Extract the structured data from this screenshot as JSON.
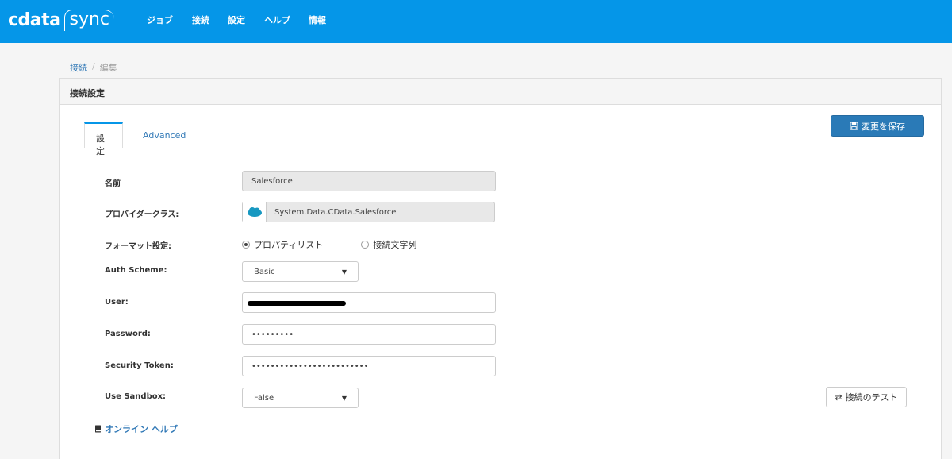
{
  "nav": {
    "logo_cdata": "cdata",
    "logo_sync": "sync",
    "items": [
      "ジョブ",
      "接続",
      "設定",
      "ヘルプ",
      "情報"
    ]
  },
  "breadcrumb": {
    "link": "接続",
    "separator": "/",
    "current": "編集"
  },
  "panel": {
    "title": "接続設定"
  },
  "tabs": {
    "settings": "設定",
    "advanced": "Advanced"
  },
  "save_button": "変更を保存",
  "form": {
    "name_label": "名前",
    "name_value": "Salesforce",
    "provider_label": "プロバイダークラス:",
    "provider_value": "System.Data.CData.Salesforce",
    "format_label": "フォーマット設定:",
    "format_options": [
      "プロパティリスト",
      "接続文字列"
    ],
    "auth_label": "Auth Scheme:",
    "auth_value": "Basic",
    "user_label": "User:",
    "password_label": "Password:",
    "password_value": "•••••••••",
    "token_label": "Security Token:",
    "token_value": "•••••••••••••••••••••••••",
    "sandbox_label": "Use Sandbox:",
    "sandbox_value": "False"
  },
  "test_button": "接続のテスト",
  "help_link": "オンライン ヘルプ",
  "colors": {
    "nav_bg": "#0596e8",
    "primary_btn": "#2a7ab7",
    "link": "#337ab7"
  }
}
